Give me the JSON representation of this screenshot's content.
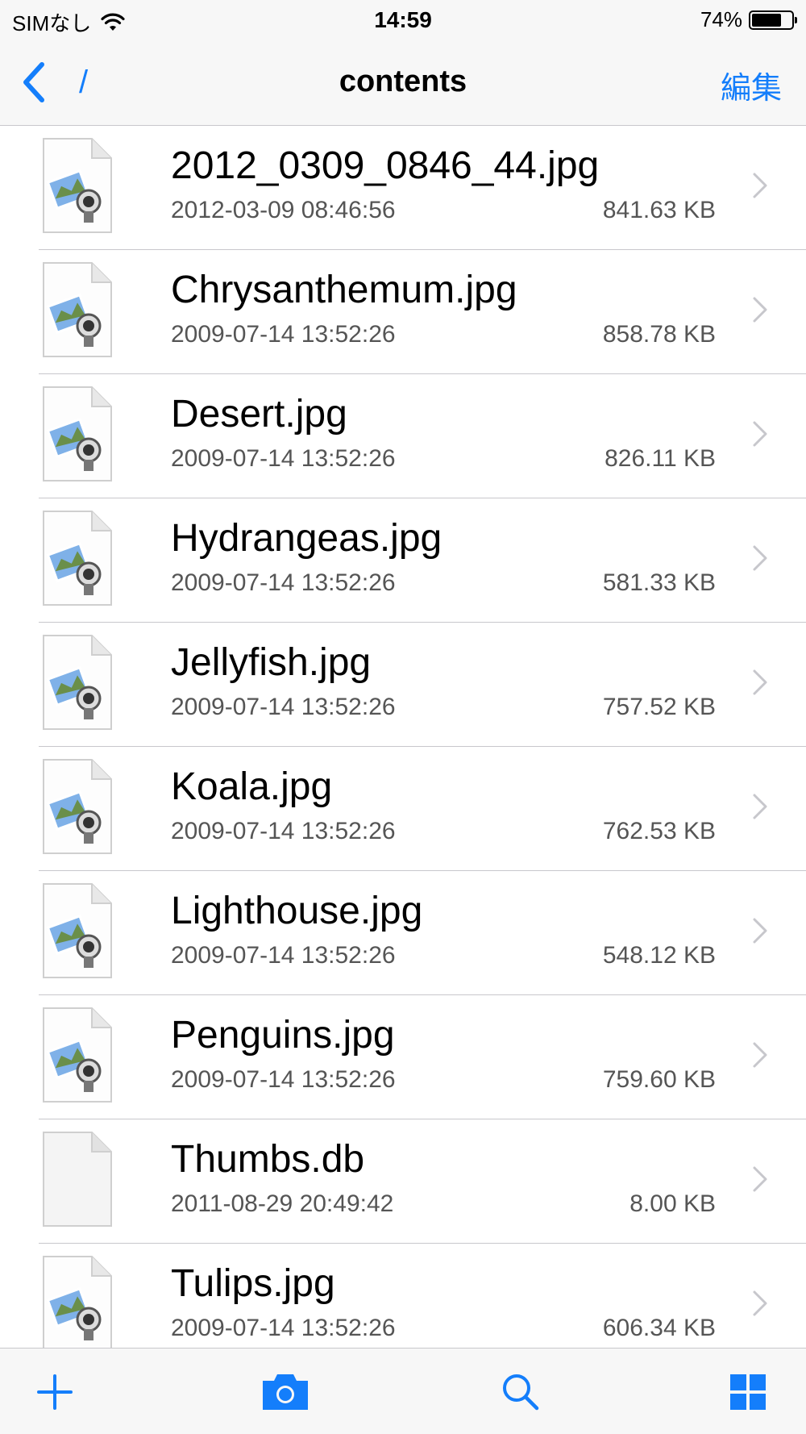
{
  "status_bar": {
    "carrier": "SIMなし",
    "time": "14:59",
    "battery_text": "74%",
    "battery_level": 0.74
  },
  "nav": {
    "back_icon": "chevron-left-icon",
    "path": "/",
    "title": "contents",
    "edit_label": "編集"
  },
  "files": [
    {
      "name": "2012_0309_0846_44.jpg",
      "date": "2012-03-09 08:46:56",
      "size": "841.63 KB",
      "icon": "image-file-icon"
    },
    {
      "name": "Chrysanthemum.jpg",
      "date": "2009-07-14 13:52:26",
      "size": "858.78 KB",
      "icon": "image-file-icon"
    },
    {
      "name": "Desert.jpg",
      "date": "2009-07-14 13:52:26",
      "size": "826.11 KB",
      "icon": "image-file-icon"
    },
    {
      "name": "Hydrangeas.jpg",
      "date": "2009-07-14 13:52:26",
      "size": "581.33 KB",
      "icon": "image-file-icon"
    },
    {
      "name": "Jellyfish.jpg",
      "date": "2009-07-14 13:52:26",
      "size": "757.52 KB",
      "icon": "image-file-icon"
    },
    {
      "name": "Koala.jpg",
      "date": "2009-07-14 13:52:26",
      "size": "762.53 KB",
      "icon": "image-file-icon"
    },
    {
      "name": "Lighthouse.jpg",
      "date": "2009-07-14 13:52:26",
      "size": "548.12 KB",
      "icon": "image-file-icon"
    },
    {
      "name": "Penguins.jpg",
      "date": "2009-07-14 13:52:26",
      "size": "759.60 KB",
      "icon": "image-file-icon"
    },
    {
      "name": "Thumbs.db",
      "date": "2011-08-29 20:49:42",
      "size": "8.00 KB",
      "icon": "generic-file-icon"
    },
    {
      "name": "Tulips.jpg",
      "date": "2009-07-14 13:52:26",
      "size": "606.34 KB",
      "icon": "image-file-icon"
    }
  ],
  "toolbar": {
    "items": [
      "add-icon",
      "camera-icon",
      "search-icon",
      "grid-view-icon"
    ]
  },
  "colors": {
    "accent": "#147efb",
    "separator": "#c8c7cc",
    "bar_background": "#f7f7f7",
    "secondary_text": "#555555"
  }
}
